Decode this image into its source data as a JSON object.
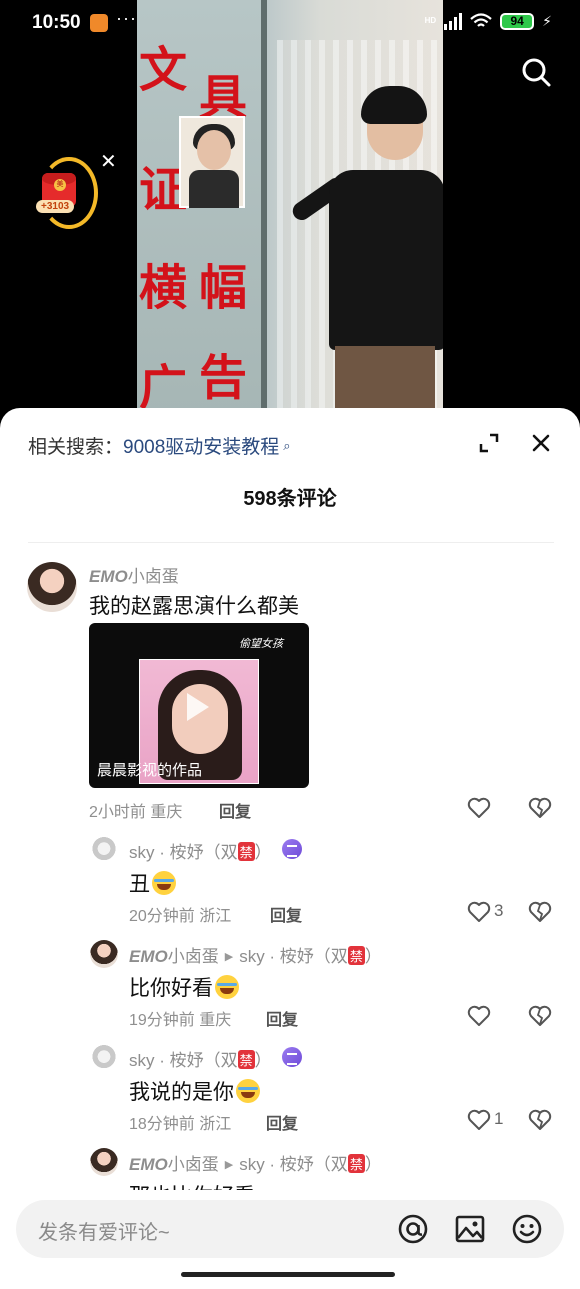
{
  "status_bar": {
    "time": "10:50",
    "dots": "···",
    "battery": "94",
    "network": "HD"
  },
  "video": {
    "glass_chars": [
      "文",
      "具",
      "证",
      "横",
      "幅",
      "广",
      "告"
    ]
  },
  "red_packet": {
    "seal": "美",
    "reward": "+3103"
  },
  "sheet": {
    "related_label": "相关搜索：",
    "related_keyword": "9008驱动安装教程",
    "comment_count_title": "598条评论"
  },
  "comments": [
    {
      "user_bold": "EMO",
      "user_rest": "小卤蛋",
      "text": "我的赵露思演什么都美",
      "video_caption": "晨晨影视的作品",
      "video_tag": "偷望女孩",
      "meta": "2小时前 重庆",
      "reply_label": "回复"
    },
    {
      "user": "sky · 桉妤（双",
      "ban": "禁",
      "user_end": "）",
      "text": "丑",
      "meta": "20分钟前 浙江",
      "reply_label": "回复",
      "likes": "3"
    },
    {
      "user_bold": "EMO",
      "user_rest": "小卤蛋",
      "reply_to": "sky · 桉妤（双",
      "ban": "禁",
      "user_end": "）",
      "text": "比你好看",
      "meta": "19分钟前 重庆",
      "reply_label": "回复"
    },
    {
      "user": "sky · 桉妤（双",
      "ban": "禁",
      "user_end": "）",
      "text": "我说的是你",
      "meta": "18分钟前 浙江",
      "reply_label": "回复",
      "likes": "1"
    },
    {
      "user_bold": "EMO",
      "user_rest": "小卤蛋",
      "reply_to": "sky · 桉妤（双",
      "ban": "禁",
      "user_end": "）",
      "text": "那也比你好看"
    }
  ],
  "input": {
    "placeholder": "发条有爱评论~"
  },
  "icons": [
    "search-icon",
    "close-icon",
    "expand-icon",
    "like-icon",
    "dislike-icon",
    "at-icon",
    "image-icon",
    "emoji-icon"
  ]
}
